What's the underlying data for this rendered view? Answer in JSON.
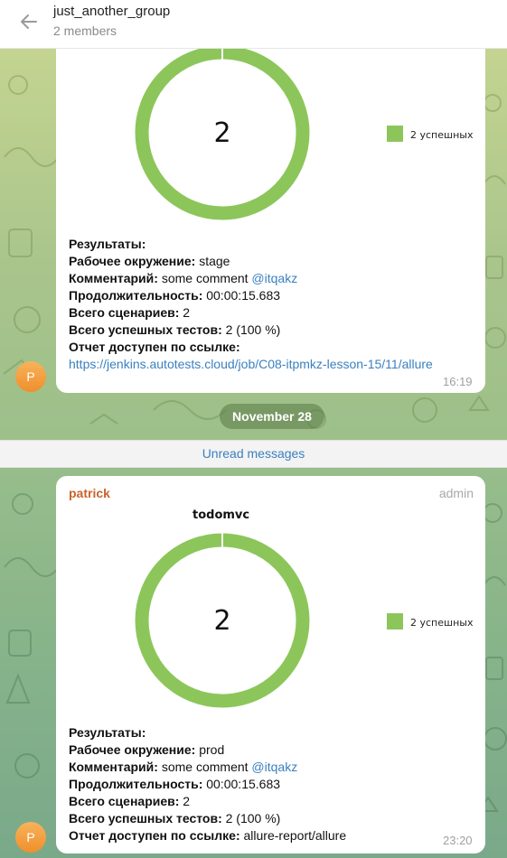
{
  "header": {
    "title": "just_another_group",
    "members": "2 members"
  },
  "date_separator": "November 28",
  "unread_label": "Unread messages",
  "colors": {
    "accent": "#3a80bf",
    "donut": "#8cc65a",
    "sender": "#c9632c"
  },
  "messages": [
    {
      "avatar_letter": "P",
      "time": "16:19",
      "chart": {
        "center_value": "2",
        "legend": "2 успешных"
      },
      "chart_data": {
        "type": "pie",
        "categories": [
          "2 успешных"
        ],
        "values": [
          2
        ]
      },
      "results_label": "Результаты:",
      "env_label": "Рабочее окружение:",
      "env_value": "stage",
      "comment_label": "Комментарий:",
      "comment_value": "some comment",
      "mention": "@itqakz",
      "duration_label": "Продолжительность:",
      "duration_value": "00:00:15.683",
      "scenarios_label": "Всего сценариев:",
      "scenarios_value": "2",
      "passed_label": "Всего успешных тестов:",
      "passed_value": "2 (100 %)",
      "report_label": "Отчет доступен по ссылке:",
      "report_link": "https://jenkins.autotests.cloud/job/C08-itpmkz-lesson-15/11/allure"
    },
    {
      "sender": "patrick",
      "role": "admin",
      "avatar_letter": "P",
      "time": "23:20",
      "chart": {
        "title": "todomvc",
        "center_value": "2",
        "legend": "2 успешных"
      },
      "chart_data": {
        "type": "pie",
        "title": "todomvc",
        "categories": [
          "2 успешных"
        ],
        "values": [
          2
        ]
      },
      "results_label": "Результаты:",
      "env_label": "Рабочее окружение:",
      "env_value": "prod",
      "comment_label": "Комментарий:",
      "comment_value": "some comment",
      "mention": "@itqakz",
      "duration_label": "Продолжительность:",
      "duration_value": "00:00:15.683",
      "scenarios_label": "Всего сценариев:",
      "scenarios_value": "2",
      "passed_label": "Всего успешных тестов:",
      "passed_value": "2 (100 %)",
      "report_label": "Отчет доступен по ссылке:",
      "report_value": "allure-report/allure"
    }
  ]
}
